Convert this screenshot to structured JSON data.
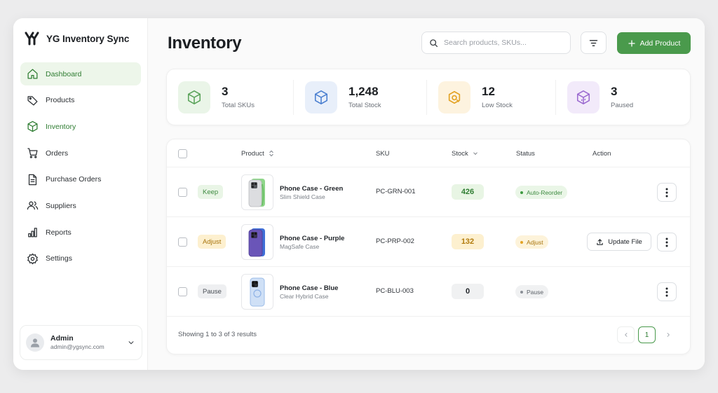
{
  "app": {
    "name": "YG Inventory Sync"
  },
  "sidebar": {
    "items": [
      {
        "label": "Dashboard",
        "icon": "home-icon"
      },
      {
        "label": "Products",
        "icon": "tag-icon"
      },
      {
        "label": "Inventory",
        "icon": "cube-icon"
      },
      {
        "label": "Orders",
        "icon": "cart-icon"
      },
      {
        "label": "Purchase Orders",
        "icon": "document-icon"
      },
      {
        "label": "Suppliers",
        "icon": "users-icon"
      },
      {
        "label": "Reports",
        "icon": "bar-chart-icon"
      },
      {
        "label": "Settings",
        "icon": "gear-icon"
      }
    ],
    "user": {
      "name": "Admin",
      "email": "admin@ygsync.com"
    }
  },
  "header": {
    "title": "Inventory",
    "search_placeholder": "Search products, SKUs...",
    "add_label": "Add Product"
  },
  "stats": [
    {
      "value": "3",
      "label": "Total SKUs",
      "icon": "cube-icon",
      "color": "#5aa35a"
    },
    {
      "value": "1,248",
      "label": "Total Stock",
      "icon": "cube-icon",
      "color": "#4a7fd0"
    },
    {
      "value": "12",
      "label": "Low Stock",
      "icon": "alert-box-icon",
      "color": "#e3a325"
    },
    {
      "value": "3",
      "label": "Paused",
      "icon": "cube-icon",
      "color": "#9b6ad0"
    }
  ],
  "table": {
    "columns": {
      "product": "Product",
      "sku": "SKU",
      "stock": "Stock",
      "status": "Status",
      "action": "Action"
    },
    "rows": [
      {
        "action": "Keep",
        "name": "Phone Case - Green",
        "variant": "Slim Shield Case",
        "sku": "PC-GRN-001",
        "stock": "426",
        "status": "Auto-Reorder",
        "case_color": "#8fd68a"
      },
      {
        "action": "Adjust",
        "name": "Phone Case - Purple",
        "variant": "MagSafe Case",
        "sku": "PC-PRP-002",
        "stock": "132",
        "status": "Adjust",
        "update_label": "Update File",
        "case_color": "#6a55b8"
      },
      {
        "action": "Pause",
        "name": "Phone Case - Blue",
        "variant": "Clear Hybrid Case",
        "sku": "PC-BLU-003",
        "stock": "0",
        "status": "Pause",
        "case_color": "#b8d2f2"
      }
    ],
    "footer": {
      "results": "Showing 1 to 3 of 3 results",
      "page": "1"
    }
  },
  "colors": {
    "brand": "#4a9a4c",
    "active_bg": "#edf6ea"
  }
}
